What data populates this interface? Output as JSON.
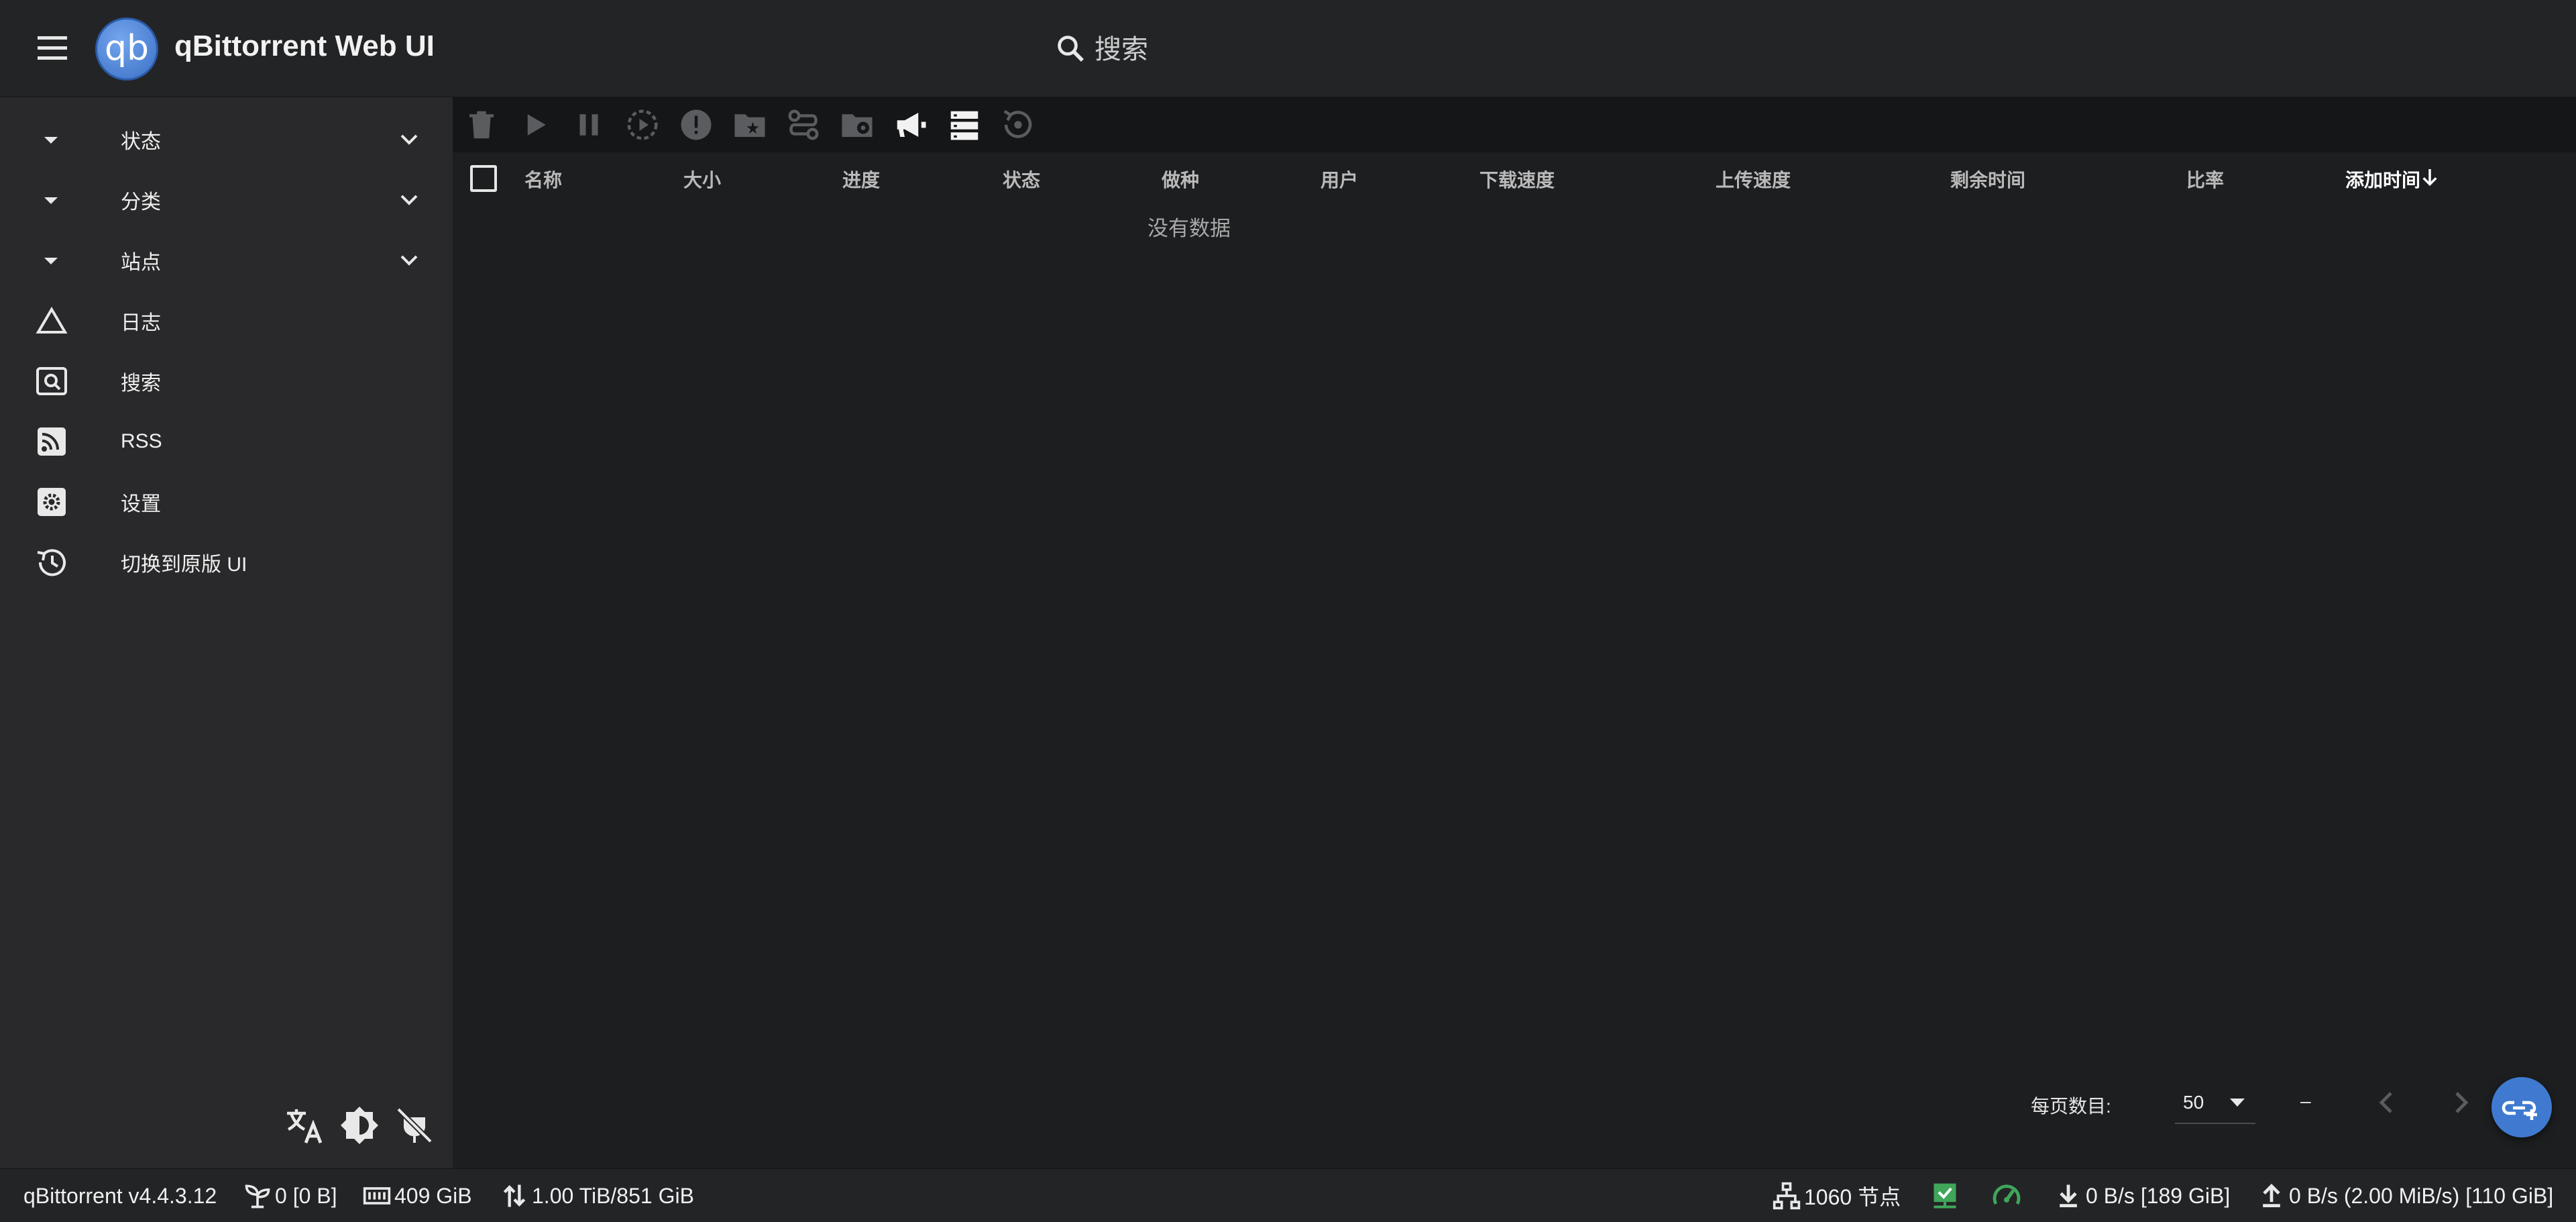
{
  "app": {
    "title": "qBittorrent Web UI",
    "logo_text": "qb"
  },
  "search": {
    "placeholder": "搜索"
  },
  "sidebar": {
    "items": [
      {
        "label": "状态",
        "icon": "caret-down-icon",
        "expandable": true
      },
      {
        "label": "分类",
        "icon": "caret-down-icon",
        "expandable": true
      },
      {
        "label": "站点",
        "icon": "caret-down-icon",
        "expandable": true
      },
      {
        "label": "日志",
        "icon": "triangle-icon"
      },
      {
        "label": "搜索",
        "icon": "search-box-icon"
      },
      {
        "label": "RSS",
        "icon": "rss-icon"
      },
      {
        "label": "设置",
        "icon": "gear-icon"
      },
      {
        "label": "切换到原版 UI",
        "icon": "history-icon"
      }
    ],
    "bottom_icons": [
      "translate-icon",
      "theme-icon",
      "power-plug-off-icon"
    ]
  },
  "toolbar": {
    "icons": [
      "delete-icon",
      "play-icon",
      "pause-icon",
      "force-start-icon",
      "alert-icon",
      "folder-star-icon",
      "transfer-icon",
      "folder-location-icon",
      "megaphone-icon",
      "server-icon",
      "recheck-icon"
    ]
  },
  "table": {
    "columns": [
      "名称",
      "大小",
      "进度",
      "状态",
      "做种",
      "用户",
      "下载速度",
      "上传速度",
      "剩余时间",
      "比率",
      "添加时间"
    ],
    "sorted_column": "添加时间",
    "sort_direction": "desc",
    "empty_text": "没有数据"
  },
  "pagination": {
    "per_page_label": "每页数目:",
    "per_page_value": "50",
    "range_text": "–"
  },
  "statusbar": {
    "version": "qBittorrent v4.4.3.12",
    "seeding": "0 [0 B]",
    "free_space": "409 GiB",
    "alltime": "1.00 TiB/851 GiB",
    "nodes": "1060 节点",
    "download": "0 B/s [189 GiB]",
    "upload": "0 B/s (2.00 MiB/s) [110 GiB]"
  },
  "colors": {
    "accent": "#3f7ad0",
    "connected": "#3fa65a",
    "sidebar_bg": "#29292b",
    "main_bg": "#1d1e20"
  }
}
